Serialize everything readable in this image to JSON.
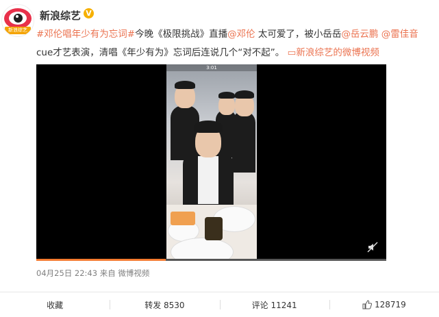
{
  "post": {
    "author": "新浪综艺",
    "avatar_badge": "新浪综艺",
    "verified_icon": "V",
    "text": {
      "hashtag": "#邓伦唱年少有为忘词#",
      "p1": "今晚《极限挑战》直播",
      "mention1": "@邓伦",
      "p2": " 太可爱了，被小岳岳",
      "mention2": "@岳云鹏",
      "mention3": "@雷佳音",
      "p3": "cue才艺表演，清唱《年少有为》忘词后连说几个“对不起”。",
      "video_link": "新浪综艺的微博视频"
    },
    "video": {
      "status_bar": "3:01",
      "progress_percent": 37
    },
    "meta": {
      "date": "04月25日 22:43",
      "source": "来自 微博视频"
    }
  },
  "actions": {
    "favorite": "收藏",
    "repost": "转发 8530",
    "comment": "评论 11241",
    "like": "128719"
  },
  "colors": {
    "accent": "#eb7350",
    "progress": "#f47b30"
  }
}
